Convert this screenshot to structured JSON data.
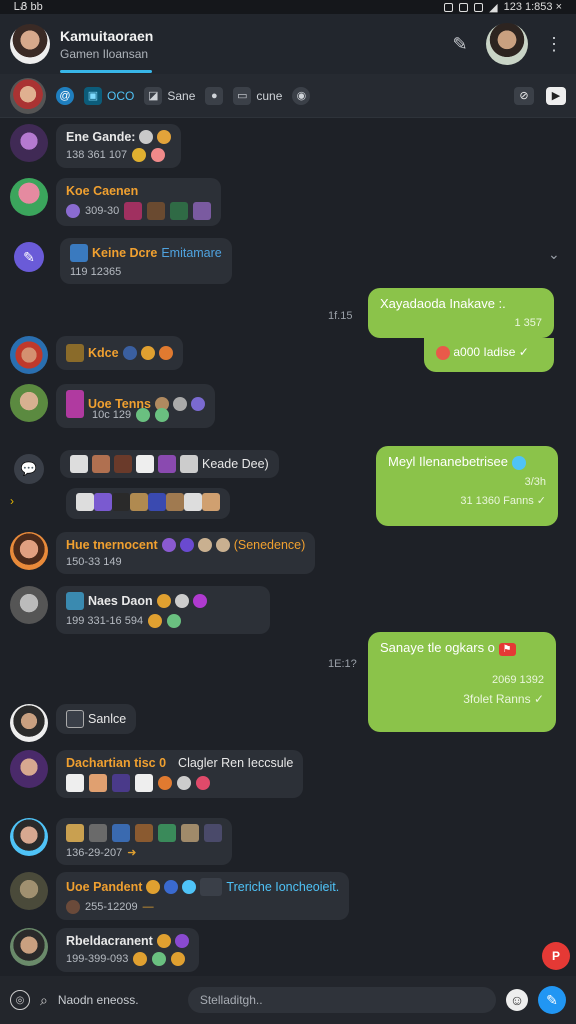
{
  "status": {
    "left": "ᏞᏰ bb",
    "right": "123 1:853 ×"
  },
  "header": {
    "title": "Kamuitaoraen",
    "subtitle": "Gamen Iloansan"
  },
  "toolbar": {
    "chips": [
      "OCO",
      "Sane",
      "cune"
    ]
  },
  "chat": {
    "msgs": [
      {
        "name": "Ene Gande:",
        "meta": "138 361 107"
      },
      {
        "name": "Koe Caenen",
        "meta": "309-30"
      },
      {
        "name": "Keine Dcre",
        "meta": "119 12365",
        "extra": "Emitamare"
      },
      {
        "name": "Kdce",
        "meta": ""
      },
      {
        "name": "Uoe Tenns",
        "meta": "10c 129"
      },
      {
        "name": "Keade Dee)",
        "meta": ""
      },
      {
        "name": "Hue tnernocent",
        "meta": "150-33 149",
        "extra": "(Senedence)"
      },
      {
        "name": "Naes Daon",
        "meta": "199 331-16 594"
      },
      {
        "name": "Sanlce",
        "meta": ""
      },
      {
        "name": "Dachartian tisc 0",
        "meta": "",
        "extra": "Clagler Ren Ieccsule"
      },
      {
        "name": "",
        "meta": "136-29-207"
      },
      {
        "name": "Uoe Pandent",
        "meta": "255-12209",
        "extra": "Treriche Ioncheoieit."
      },
      {
        "name": "Rbeldacranent",
        "meta": "199-399-093"
      }
    ],
    "out": [
      {
        "text": "Xayadaoda Inakave :.",
        "meta1": "1 357",
        "meta2": "a000 Iadise"
      },
      {
        "text": "Meyl Ilenanebetrisee",
        "meta1": "3/3h",
        "meta2": "31 1360 Fanns"
      },
      {
        "text": "Sanaye tle ogkars o",
        "meta1": "2069 1392",
        "meta2": "3folet Ranns"
      }
    ],
    "timestamps": [
      "1f.15",
      "1E:1?"
    ]
  },
  "composer": {
    "search_label": "Naodn eneoss.",
    "placeholder": "Stelladitgh.."
  },
  "fab_label": "P"
}
